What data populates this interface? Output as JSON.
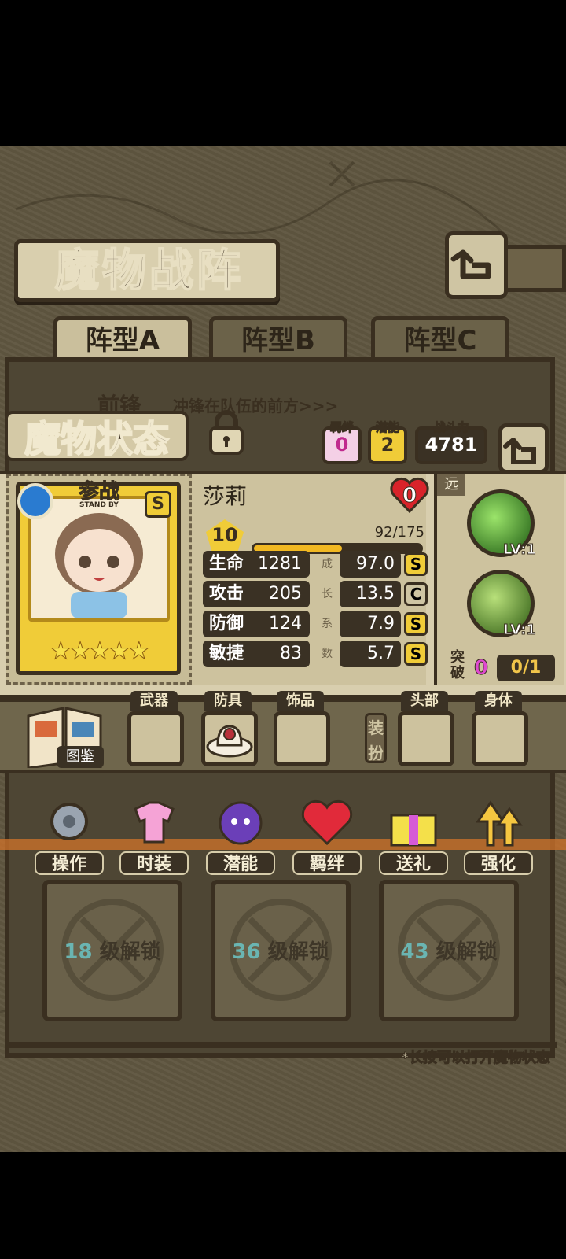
{
  "screen_title": "魔物战阵",
  "tabs": [
    {
      "label": "阵型A",
      "active": true
    },
    {
      "label": "阵型B",
      "active": false
    },
    {
      "label": "阵型C",
      "active": false
    }
  ],
  "vanguard": {
    "label": "前锋",
    "desc": "冲锋在队伍的前方>>>"
  },
  "status": {
    "title": "魔物状态",
    "bond_label": "羁绊",
    "bond_value": "0",
    "potential_label": "潜能",
    "potential_value": "2",
    "power_label": "战斗力",
    "power_value": "4781"
  },
  "card": {
    "standby_label": "参战",
    "standby_sub": "STAND BY",
    "rank": "S",
    "stars": "★★★★★",
    "star_count": 5
  },
  "monster": {
    "name": "莎莉",
    "heart_value": "0",
    "level": "10",
    "exp_text": "92/175",
    "exp_fraction": 0.526
  },
  "stats": [
    {
      "label": "生命",
      "value": "1281",
      "growth": "97.0",
      "grade": "S"
    },
    {
      "label": "攻击",
      "value": "205",
      "growth": "13.5",
      "grade": "C"
    },
    {
      "label": "防御",
      "value": "124",
      "growth": "7.9",
      "grade": "S"
    },
    {
      "label": "敏捷",
      "value": "83",
      "growth": "5.7",
      "grade": "S"
    }
  ],
  "growth_chars": [
    "成",
    "长",
    "系",
    "数"
  ],
  "skills": {
    "range_label": "远",
    "skill1_level": "LV:1",
    "skill2_level": "LV:1",
    "break_label": "突破",
    "break_value": "0",
    "break_progress": "0/1"
  },
  "equipment": {
    "book_label": "图鉴",
    "slots": [
      {
        "label": "武器"
      },
      {
        "label": "防具"
      },
      {
        "label": "饰品"
      },
      {
        "label": "头部"
      },
      {
        "label": "身体"
      }
    ],
    "dress_label": "装扮"
  },
  "actions": [
    {
      "label": "操作"
    },
    {
      "label": "时装"
    },
    {
      "label": "潜能"
    },
    {
      "label": "羁绊"
    },
    {
      "label": "送礼"
    },
    {
      "label": "强化"
    }
  ],
  "locked_slots": [
    {
      "level": "18",
      "text": "级解锁"
    },
    {
      "level": "36",
      "text": "级解锁"
    },
    {
      "level": "43",
      "text": "级解锁"
    }
  ],
  "hint": "*长按可以打开魔物状态",
  "colors": {
    "accent": "#f0cc38",
    "frame": "#3a2f20",
    "parchment": "#d8ceae"
  }
}
